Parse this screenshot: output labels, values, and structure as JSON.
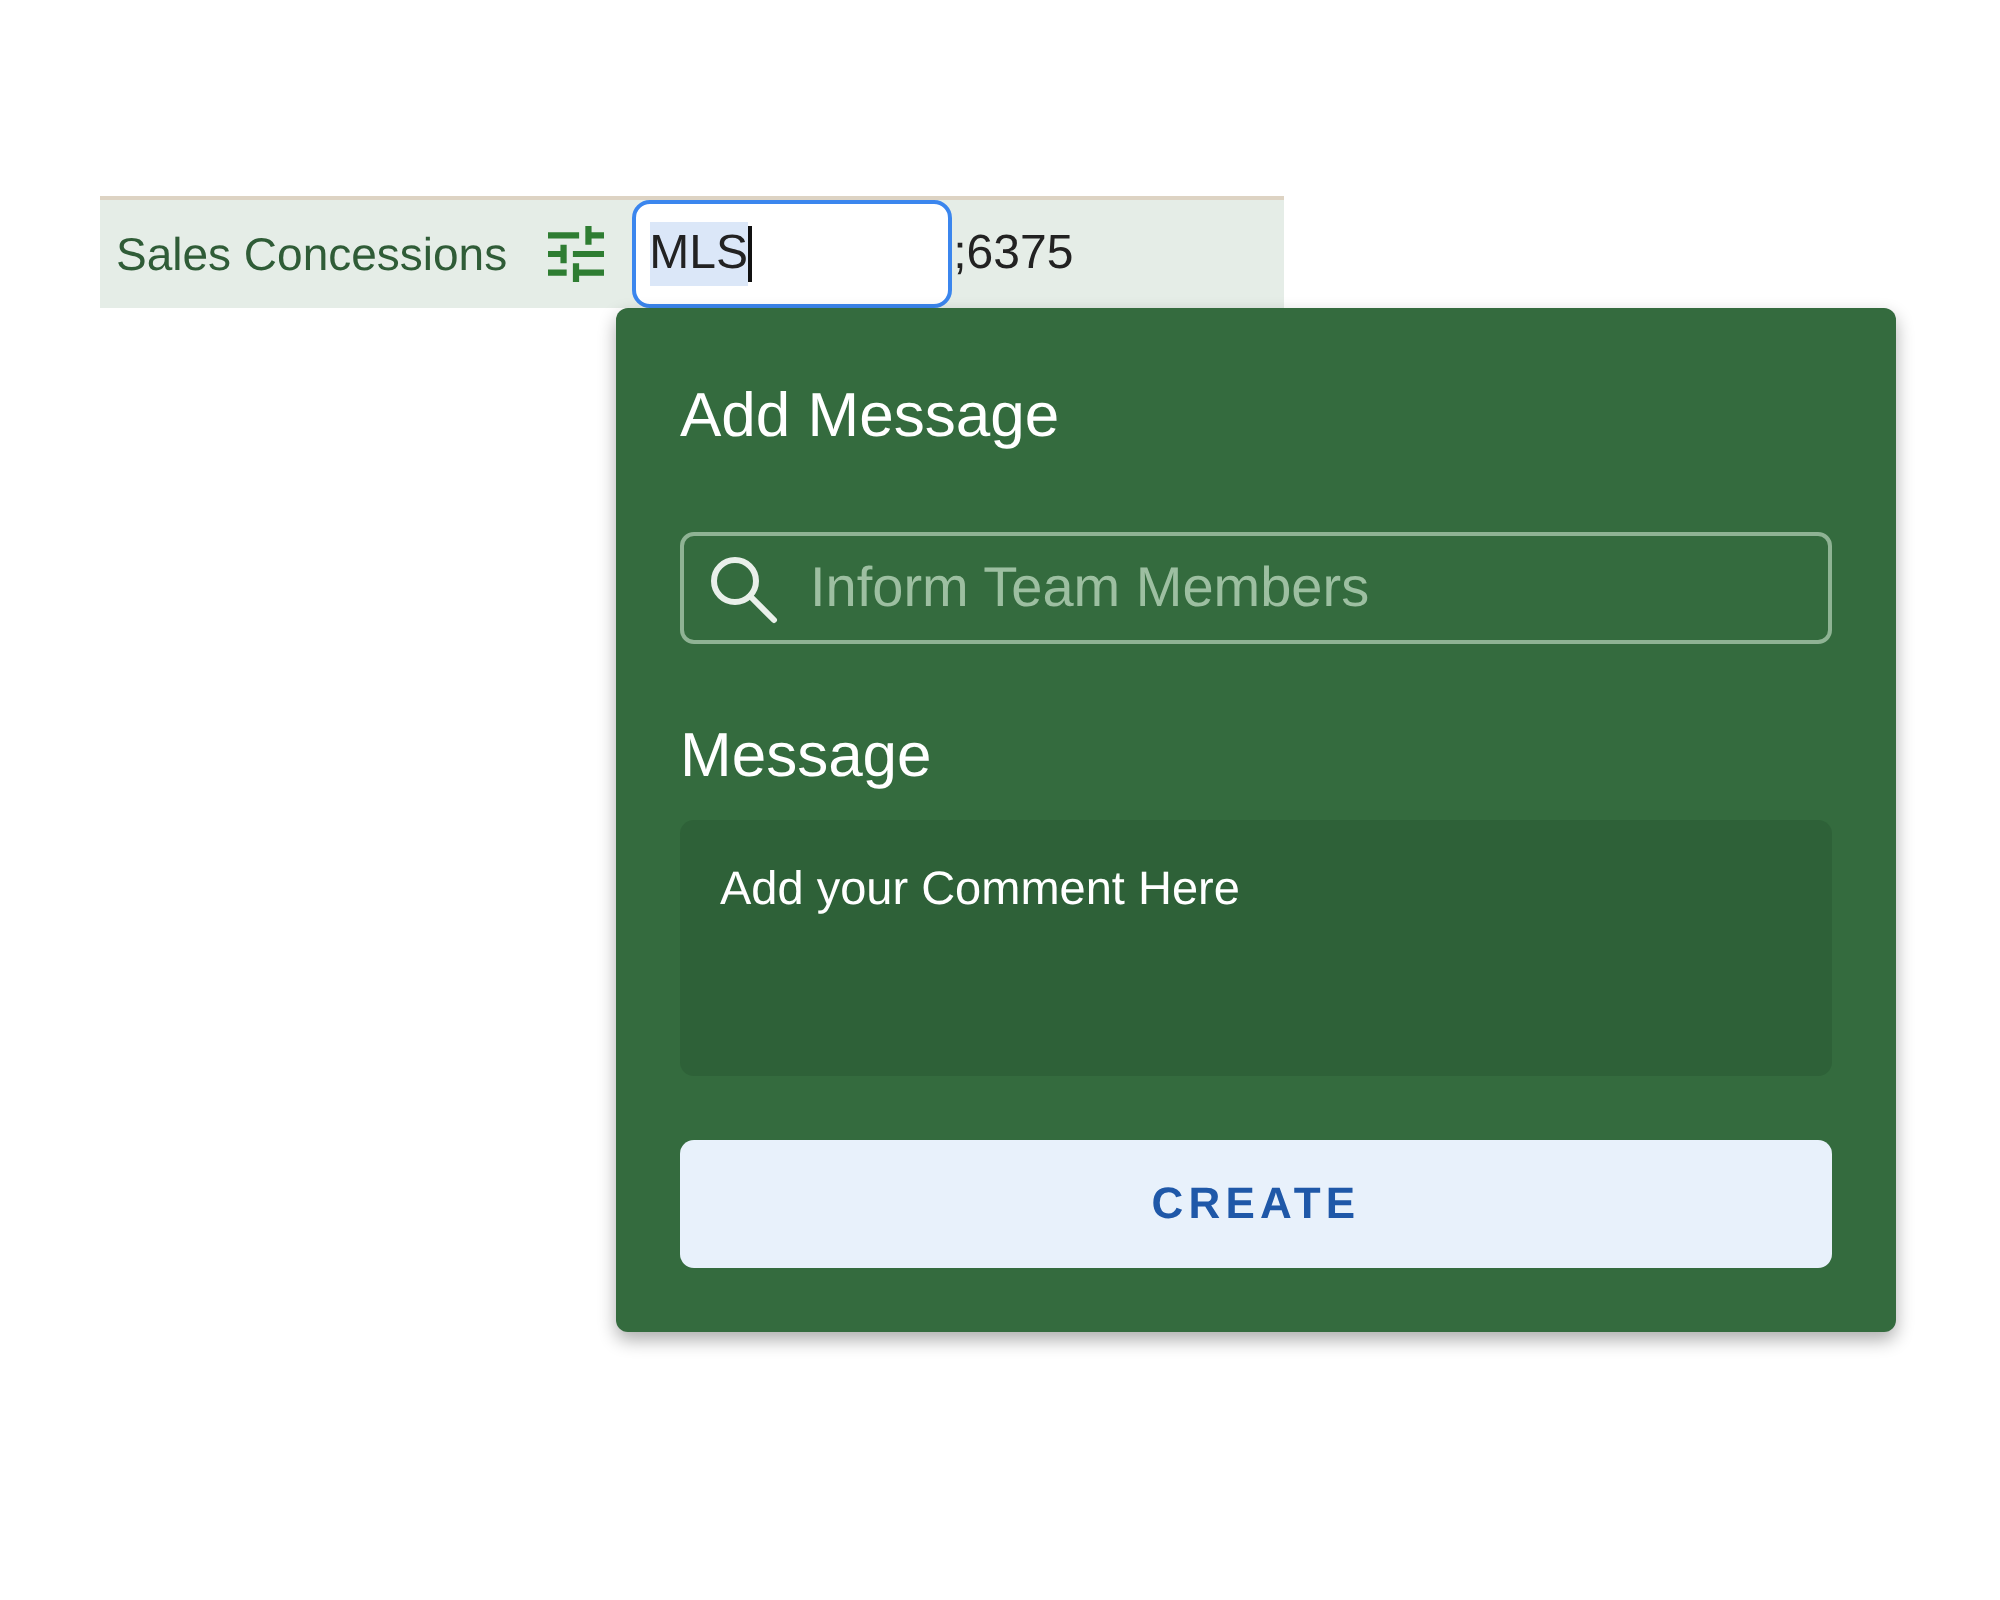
{
  "row": {
    "label": "Sales Concessions",
    "input": {
      "value": "MLS",
      "focused": true,
      "value_selected": true
    },
    "trailing_text": ";6375"
  },
  "dialog": {
    "title": "Add Message",
    "search": {
      "placeholder": "Inform Team Members"
    },
    "message_label": "Message",
    "message": {
      "placeholder": "Add your Comment Here"
    },
    "create_button": {
      "label": "CREATE"
    }
  }
}
